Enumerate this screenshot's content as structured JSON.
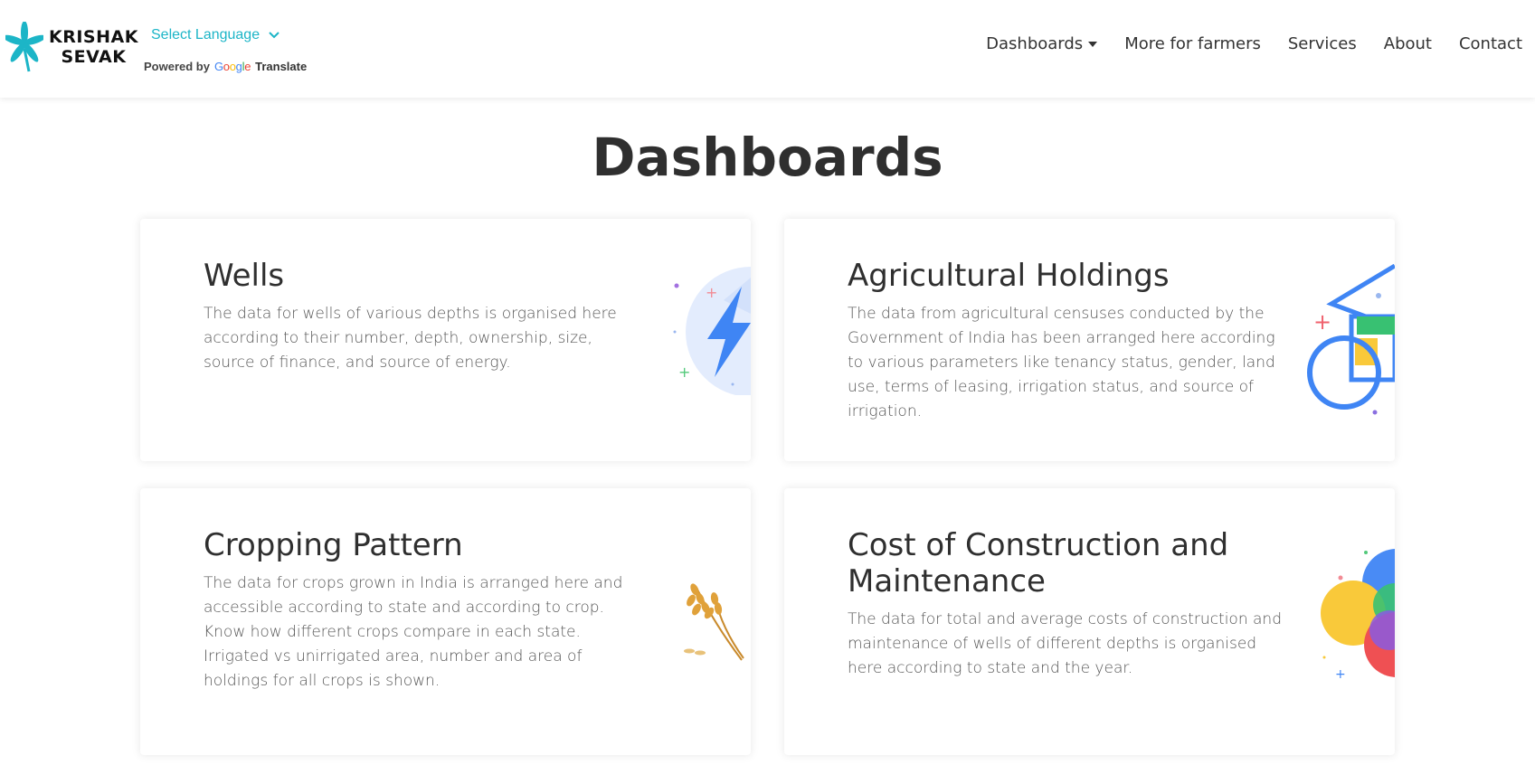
{
  "brand": {
    "line1": "KRISHAK",
    "line2": "SEVAK",
    "logo_icon": "leaf-star-logo",
    "accent": "#1cb5c7"
  },
  "translate": {
    "select_label": "Select Language",
    "powered_by": "Powered by",
    "google": [
      "G",
      "o",
      "o",
      "g",
      "l",
      "e"
    ],
    "translate_word": "Translate"
  },
  "nav": {
    "dashboards": "Dashboards",
    "more_for_farmers": "More for farmers",
    "services": "Services",
    "about": "About",
    "contact": "Contact"
  },
  "page": {
    "title": "Dashboards"
  },
  "cards": [
    {
      "title": "Wells",
      "description": "The data for wells of various depths is organised here according to their number, depth, ownership, size, source of finance, and source of energy.",
      "icon": "lightning-bolt-icon"
    },
    {
      "title": "Agricultural Holdings",
      "description": "The data from agricultural censuses conducted by the Government of India has been arranged here according to various parameters like tenancy status, gender, land use, terms of leasing, irrigation status, and source of irrigation.",
      "icon": "tractor-wheel-icon"
    },
    {
      "title": "Cropping Pattern",
      "description": "The data for crops grown in India is arranged here and accessible according to state and according to crop. Know how different crops compare in each state. Irrigated vs unirrigated area, number and area of holdings for all crops is shown.",
      "icon": "wheat-icon"
    },
    {
      "title": "Cost of Construction and Maintenance",
      "description": "The data for total and average costs of construction and maintenance of wells of different depths is organised here according to state and the year.",
      "icon": "overlapping-circles-icon"
    }
  ]
}
